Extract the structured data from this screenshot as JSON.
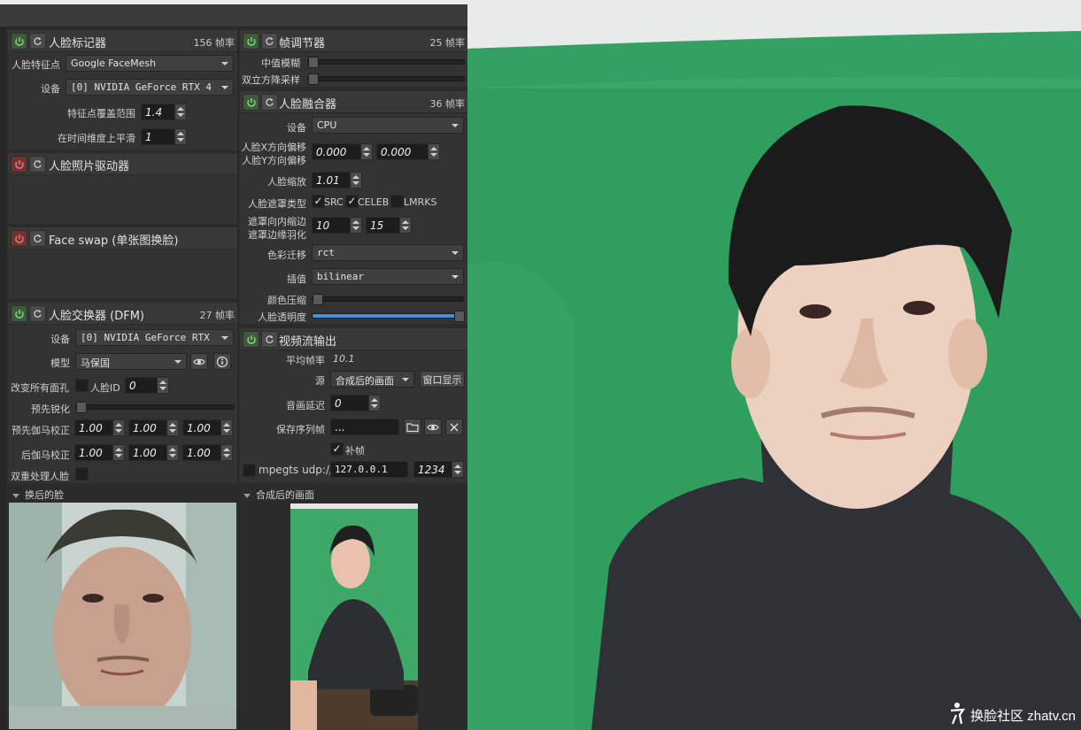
{
  "app": {
    "bg": "#2b2b2b",
    "accent": "#4a8fd8"
  },
  "landmarks": {
    "title": "人脸标记器",
    "fps": "156 帧率",
    "label_landmarks": "人脸特征点",
    "landmarks_value": "Google FaceMesh",
    "label_device": "设备",
    "device_value": "[0] NVIDIA GeForce RTX 4",
    "label_range": "特征点覆盖范围",
    "range_value": "1.4",
    "label_smooth": "在时间维度上平滑",
    "smooth_value": "1"
  },
  "photo_driver": {
    "title": "人脸照片驱动器"
  },
  "faceswap_single": {
    "title": "Face swap (单张图换脸)"
  },
  "dfm": {
    "title": "人脸交换器 (DFM)",
    "fps": "27 帧率",
    "label_device": "设备",
    "device_value": "[0] NVIDIA GeForce RTX",
    "label_model": "模型",
    "model_value": "马保国",
    "label_swap_all": "改变所有面孔",
    "label_face_id": "人脸ID",
    "face_id_value": "0",
    "label_presharpen": "预先锐化",
    "label_pre_gamma": "预先伽马校正",
    "pre_gamma": [
      "1.00",
      "1.00",
      "1.00"
    ],
    "label_post_gamma": "后伽马校正",
    "post_gamma": [
      "1.00",
      "1.00",
      "1.00"
    ],
    "label_two_pass": "双重处理人脸"
  },
  "frame_adjuster": {
    "title": "帧调节器",
    "fps": "25 帧率",
    "label_median": "中值模糊",
    "label_bilateral": "双立方降采样",
    "median_level": 0.0,
    "bilateral_level": 0.0
  },
  "merger": {
    "title": "人脸融合器",
    "fps": "36 帧率",
    "label_device": "设备",
    "device_value": "CPU",
    "label_xoff": "人脸X方向偏移",
    "label_yoff": "人脸Y方向偏移",
    "xoff_value": "0.000",
    "yoff_value": "0.000",
    "label_scale": "人脸缩放",
    "scale_value": "1.01",
    "label_mask_type": "人脸遮罩类型",
    "mask_src": "SRC",
    "mask_celeb": "CELEB",
    "mask_lmrks": "LMRKS",
    "label_erode": "遮罩向内缩边",
    "label_blur": "遮罩边缘羽化",
    "erode_value": "10",
    "blur_value": "15",
    "label_color_transfer": "色彩迁移",
    "color_transfer_value": "rct",
    "label_interp": "插值",
    "interp_value": "bilinear",
    "label_color_compress": "颜色压缩",
    "label_opacity": "人脸透明度",
    "color_compress_level": 0.0,
    "opacity_level": 1.0
  },
  "stream": {
    "title": "视频流输出",
    "label_avg_fps": "平均帧率",
    "avg_fps_value": "10.1",
    "label_source": "源",
    "source_value": "合成后的画面",
    "window_btn": "窗口显示",
    "label_delay": "音画延迟",
    "delay_value": "0",
    "label_save": "保存序列帧",
    "save_path": "...",
    "fill_frames": "补帧",
    "mpegts_label": "mpegts udp://",
    "ip_value": "127.0.0.1",
    "port_value": "1234"
  },
  "previews": {
    "swapped_label": "换后的脸",
    "merged_label": "合成后的画面"
  },
  "watermark": {
    "text": "换脸社区 zhatv.cn"
  }
}
